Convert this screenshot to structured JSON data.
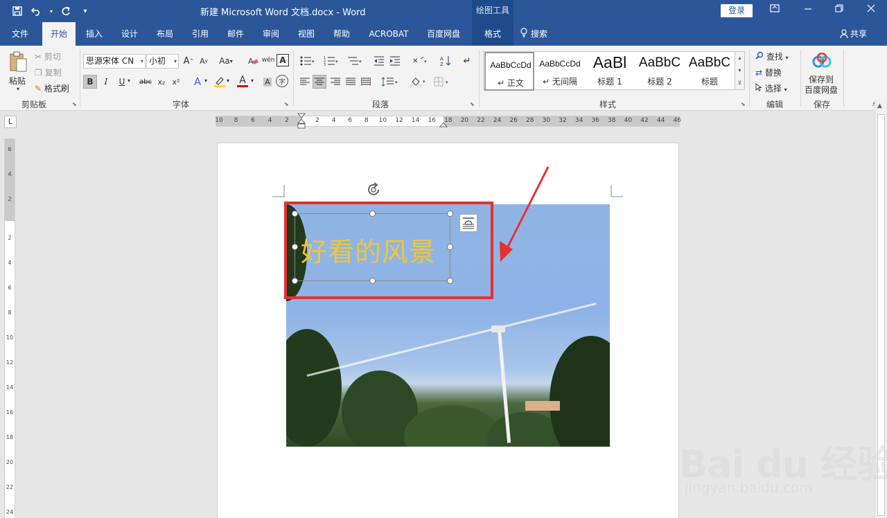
{
  "titlebar": {
    "doc_title": "新建 Microsoft Word 文档.docx  -  Word",
    "context_tools": "绘图工具",
    "login": "登录"
  },
  "tabs": [
    {
      "label": "文件"
    },
    {
      "label": "开始"
    },
    {
      "label": "插入"
    },
    {
      "label": "设计"
    },
    {
      "label": "布局"
    },
    {
      "label": "引用"
    },
    {
      "label": "邮件"
    },
    {
      "label": "审阅"
    },
    {
      "label": "视图"
    },
    {
      "label": "帮助"
    },
    {
      "label": "ACROBAT"
    },
    {
      "label": "百度网盘"
    },
    {
      "label": "格式"
    }
  ],
  "search_label": "搜索",
  "share_label": "共享",
  "clipboard": {
    "paste": "粘贴",
    "cut": "剪切",
    "copy": "复制",
    "format_painter": "格式刷",
    "group": "剪贴板"
  },
  "font": {
    "name": "思源宋体 CN",
    "size": "小初",
    "group": "字体",
    "grow": "A",
    "shrink": "A",
    "case": "Aa",
    "phonetic": "wén",
    "border": "A",
    "bold": "B",
    "italic": "I",
    "underline": "U",
    "strike": "abc",
    "sub": "x₂",
    "sup": "x²",
    "effects": "A",
    "color": "A",
    "circled": "字"
  },
  "paragraph": {
    "group": "段落"
  },
  "styles": {
    "group": "样式",
    "items": [
      {
        "sample": "AaBbCcDd",
        "name": "↵ 正文"
      },
      {
        "sample": "AaBbCcDd",
        "name": "↵ 无间隔"
      },
      {
        "sample": "AaBl",
        "name": "标题 1"
      },
      {
        "sample": "AaBbC",
        "name": "标题 2"
      },
      {
        "sample": "AaBbC",
        "name": "标题"
      }
    ]
  },
  "editing": {
    "find": "查找",
    "replace": "替换",
    "select": "选择",
    "group": "编辑"
  },
  "save": {
    "label_line1": "保存到",
    "label_line2": "百度网盘",
    "group": "保存"
  },
  "ruler": {
    "tab_selector": "L",
    "h_numbers": [
      "10",
      "8",
      "6",
      "4",
      "2",
      "2",
      "4",
      "6",
      "8",
      "10",
      "12",
      "14",
      "16",
      "18",
      "20",
      "22",
      "24",
      "26",
      "28",
      "30",
      "32",
      "34",
      "36",
      "38",
      "40",
      "42",
      "44",
      "46"
    ],
    "v_numbers": [
      "6",
      "4",
      "2",
      "2",
      "4",
      "6",
      "8",
      "10",
      "12",
      "14",
      "16",
      "18",
      "20",
      "22",
      "24"
    ]
  },
  "document": {
    "textbox_text": "好看的风景"
  },
  "watermark": {
    "logo": "Bai du 经验",
    "url": "jingyan.baidu.com"
  },
  "colors": {
    "word_blue": "#2b579a",
    "annotation_red": "#e8312f",
    "text_gold": "#f0c53a"
  }
}
